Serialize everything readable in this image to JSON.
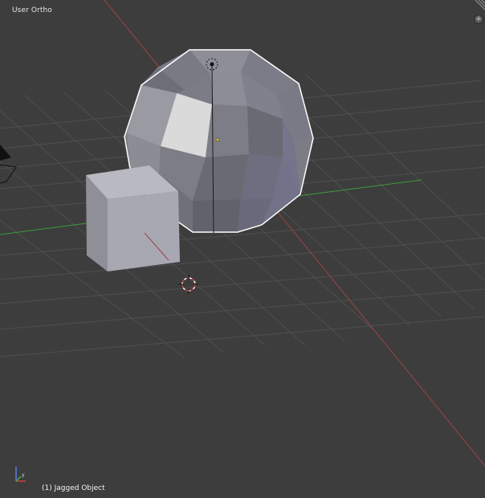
{
  "viewport": {
    "view_name": "User Ortho",
    "object_info": "(1) Jagged Object",
    "plus_icon": "+",
    "colors": {
      "background": "#3d3d3d",
      "grid": "#4d4d4d",
      "x_axis": "#8a3d3d",
      "y_axis": "#3d8a3d",
      "selection_outline": "#ffffff"
    }
  },
  "axis_gizmo": {
    "x": "x",
    "y": "y",
    "z": "z"
  }
}
